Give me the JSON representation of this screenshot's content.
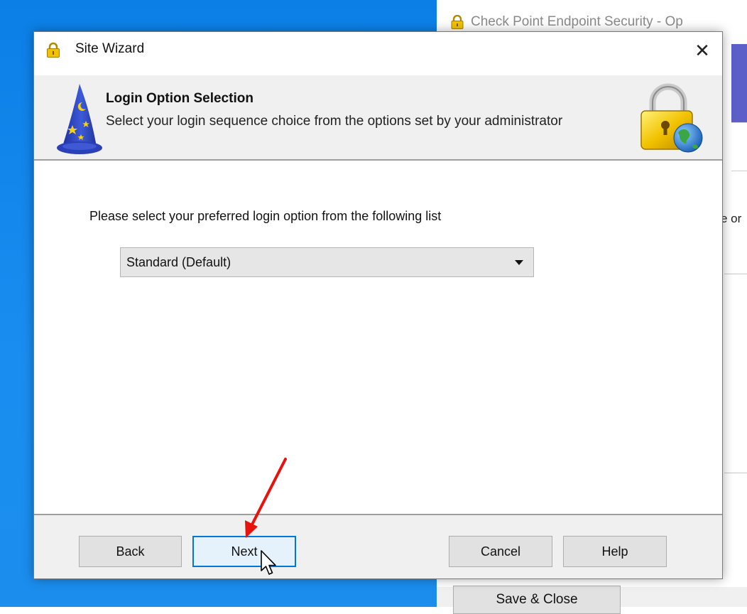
{
  "background_window": {
    "title": "Check Point Endpoint Security - Op",
    "partial_text": "e or",
    "save_close_label": "Save & Close"
  },
  "dialog": {
    "title": "Site Wizard",
    "close_glyph": "✕"
  },
  "header": {
    "title": "Login Option Selection",
    "subtitle": "Select your login sequence choice from the options set by your administrator"
  },
  "body": {
    "prompt": "Please select your preferred  login option from the following list",
    "login_option": {
      "selected": "Standard  (Default)"
    }
  },
  "footer": {
    "back_label": "Back",
    "next_label": "Next",
    "cancel_label": "Cancel",
    "help_label": "Help"
  },
  "colors": {
    "desktop": "#0a84e8",
    "focus_border": "#0078d7",
    "annotation_arrow": "#e8120c"
  },
  "icons": {
    "title": "padlock-icon",
    "header_left": "wizard-hat-icon",
    "header_right": "lock-globe-icon",
    "dropdown": "chevron-down-icon",
    "pointer": "mouse-cursor-icon",
    "annotation": "red-arrow-icon"
  }
}
